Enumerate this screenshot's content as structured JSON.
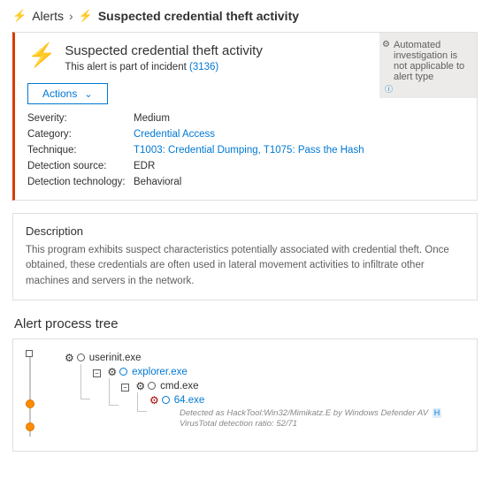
{
  "breadcrumb": {
    "root": "Alerts",
    "current": "Suspected credential theft activity"
  },
  "auto_panel": {
    "text": "Automated investigation is not applicable to alert type"
  },
  "header": {
    "title": "Suspected credential theft activity",
    "incident_prefix": "This alert is part of incident",
    "incident_id": "(3136)"
  },
  "actions": {
    "label": "Actions"
  },
  "meta": {
    "severity_label": "Severity:",
    "severity_value": "Medium",
    "category_label": "Category:",
    "category_value": "Credential Access",
    "technique_label": "Technique:",
    "technique_value": "T1003: Credential Dumping, T1075: Pass the Hash",
    "source_label": "Detection source:",
    "source_value": "EDR",
    "tech_label": "Detection technology:",
    "tech_value": "Behavioral"
  },
  "description": {
    "title": "Description",
    "body": "This program exhibits suspect characteristics potentially associated with credential theft. Once obtained, these credentials are often used in lateral movement activities to infiltrate other machines and servers in the network."
  },
  "tree": {
    "title": "Alert process tree",
    "n0": "userinit.exe",
    "n1": "explorer.exe",
    "n2": "cmd.exe",
    "n3": "64.exe",
    "detected_line1": "Detected as HackTool:Win32/Mimikatz.E by Windows Defender AV",
    "detected_badge": "H",
    "detected_line2": "VirusTotal detection ratio: 52/71"
  }
}
